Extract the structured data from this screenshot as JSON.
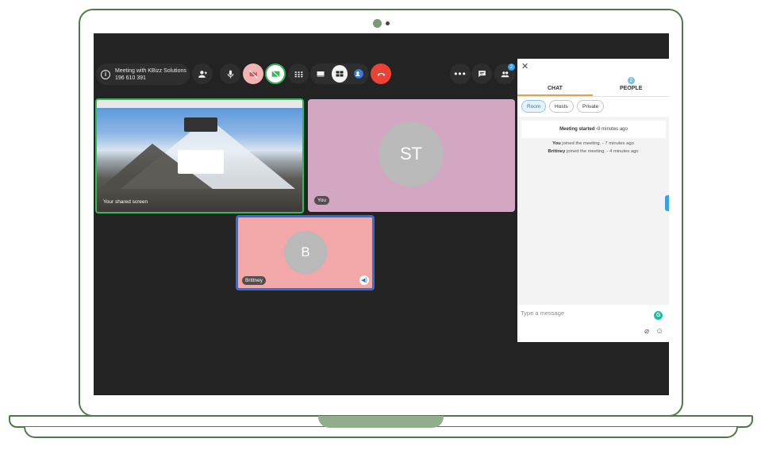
{
  "meeting": {
    "title": "Meeting with KBizz Solutions",
    "id": "196 610 391"
  },
  "tiles": {
    "share_label": "Your shared screen",
    "you_label": "You",
    "you_initials": "ST",
    "brittney_label": "Brittney",
    "brittney_initials": "B"
  },
  "toolbar": {
    "people_count": "2"
  },
  "chat": {
    "tab_chat": "CHAT",
    "tab_people": "PEOPLE",
    "people_badge": "2",
    "chips": [
      "Room",
      "Hosts",
      "Private"
    ],
    "meeting_started_bold": "Meeting started -",
    "meeting_started_time": " 9 minutes ago",
    "events": [
      {
        "name": "You",
        "text": " joined the meeting. - 7 minutes ago"
      },
      {
        "name": "Brittney",
        "text": " joined the meeting. - 4 minutes ago"
      }
    ],
    "input_placeholder": "Type a message"
  },
  "colors": {
    "accent_green": "#2ebd55",
    "end_call": "#ea4335",
    "active_speaker": "#2d6ee0"
  }
}
